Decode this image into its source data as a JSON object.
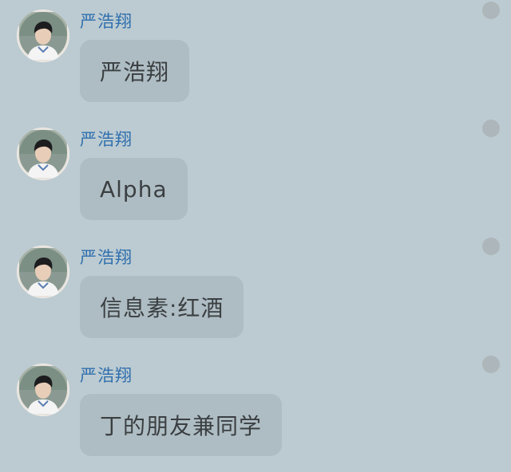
{
  "messages": [
    {
      "sender": "严浩翔",
      "text": "严浩翔",
      "avatar_icon": "user-avatar-icon"
    },
    {
      "sender": "严浩翔",
      "text": "Alpha",
      "avatar_icon": "user-avatar-icon"
    },
    {
      "sender": "严浩翔",
      "text": "信息素:红酒",
      "avatar_icon": "user-avatar-icon"
    },
    {
      "sender": "严浩翔",
      "text": "丁的朋友兼同学",
      "avatar_icon": "user-avatar-icon"
    }
  ],
  "colors": {
    "background": "#bccbd1",
    "bubble": "#aebdc3",
    "sender_name": "#2f6fae",
    "message_text": "#3b3f42",
    "status_dot": "#adb6ba"
  }
}
